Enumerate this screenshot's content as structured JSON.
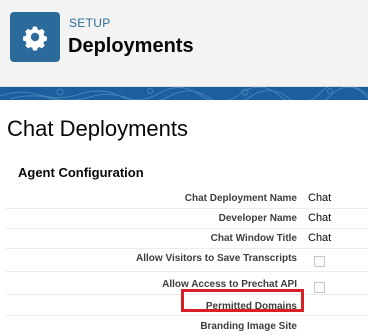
{
  "header": {
    "setup_label": "SETUP",
    "title": "Deployments",
    "icon": "gear-icon",
    "icon_bg": "#2b6b9c"
  },
  "page": {
    "title": "Chat Deployments"
  },
  "section": {
    "title": "Agent Configuration"
  },
  "fields": [
    {
      "label": "Chat Deployment Name",
      "value": "Chat"
    },
    {
      "label": "Developer Name",
      "value": "Chat"
    },
    {
      "label": "Chat Window Title",
      "value": "Chat"
    },
    {
      "label": "Allow Visitors to Save Transcripts",
      "checked": false
    },
    {
      "label": "Allow Access to Prechat API",
      "checked": false
    },
    {
      "label": "Permitted Domains",
      "value": ""
    },
    {
      "label": "Branding Image Site",
      "value": ""
    }
  ],
  "highlight_color": "#d91f26"
}
